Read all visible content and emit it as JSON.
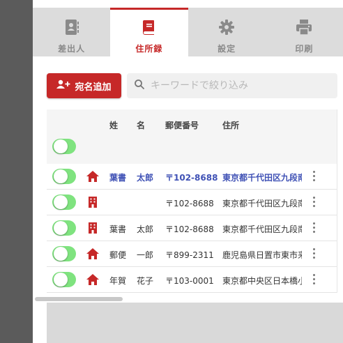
{
  "tabs": [
    {
      "label": "差出人",
      "icon": "contact-card-icon",
      "active": false
    },
    {
      "label": "住所録",
      "icon": "address-book-icon",
      "active": true
    },
    {
      "label": "設定",
      "icon": "gear-icon",
      "active": false
    },
    {
      "label": "印刷",
      "icon": "printer-icon",
      "active": false
    }
  ],
  "toolbar": {
    "add_label": "宛名追加",
    "search_placeholder": "キーワードで絞り込み"
  },
  "table": {
    "headers": {
      "sei": "姓",
      "mei": "名",
      "zip": "郵便番号",
      "address": "住所"
    },
    "rows": [
      {
        "enabled": true,
        "type": "home-icon",
        "sei": "葉書",
        "mei": "太郎",
        "zip": "〒102-8688",
        "address": "東京都千代田区九段南",
        "selected": true
      },
      {
        "enabled": true,
        "type": "building-icon",
        "sei": "",
        "mei": "",
        "zip": "〒102-8688",
        "address": "東京都千代田区九段南",
        "selected": false
      },
      {
        "enabled": true,
        "type": "building-icon",
        "sei": "葉書",
        "mei": "太郎",
        "zip": "〒102-8688",
        "address": "東京都千代田区九段南",
        "selected": false
      },
      {
        "enabled": true,
        "type": "home-icon",
        "sei": "郵便",
        "mei": "一郎",
        "zip": "〒899-2311",
        "address": "鹿児島県日置市東市来",
        "selected": false
      },
      {
        "enabled": true,
        "type": "home-icon",
        "sei": "年賀",
        "mei": "花子",
        "zip": "〒103-0001",
        "address": "東京都中央区日本橋小",
        "selected": false
      }
    ]
  },
  "colors": {
    "accent": "#c62828",
    "toggle_on": "#7fe37f",
    "selected_text": "#3f51b5"
  }
}
